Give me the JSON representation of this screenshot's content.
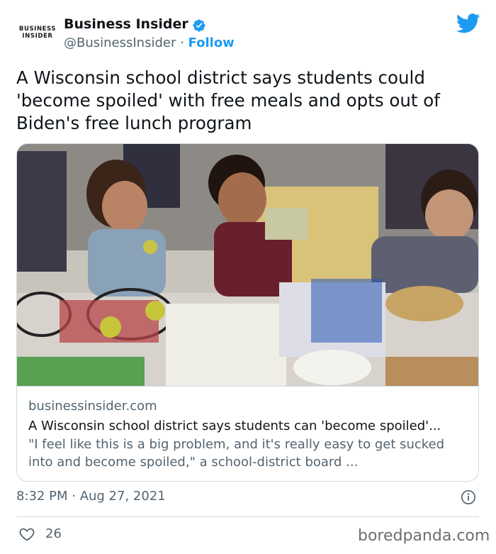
{
  "header": {
    "logo_line1": "BUSINESS",
    "logo_line2": "INSIDER",
    "author_name": "Business Insider",
    "handle": "@BusinessInsider",
    "separator": " · ",
    "follow_label": "Follow",
    "brand_color": "#1d9bf0"
  },
  "tweet": {
    "text": "A Wisconsin school district says students could 'become spoiled' with free meals and opts out of Biden's free lunch program"
  },
  "card": {
    "image_icon": "photo-of-children-in-school-lunch-line",
    "domain": "businessinsider.com",
    "title": "A Wisconsin school district says students can 'become spoiled'...",
    "description": "\"I feel like this is a big problem, and it's really easy to get sucked into and become spoiled,\" a school-district board ..."
  },
  "footer": {
    "timestamp": "8:32 PM · Aug 27, 2021",
    "like_count": "26",
    "watermark": "boredpanda.com"
  }
}
